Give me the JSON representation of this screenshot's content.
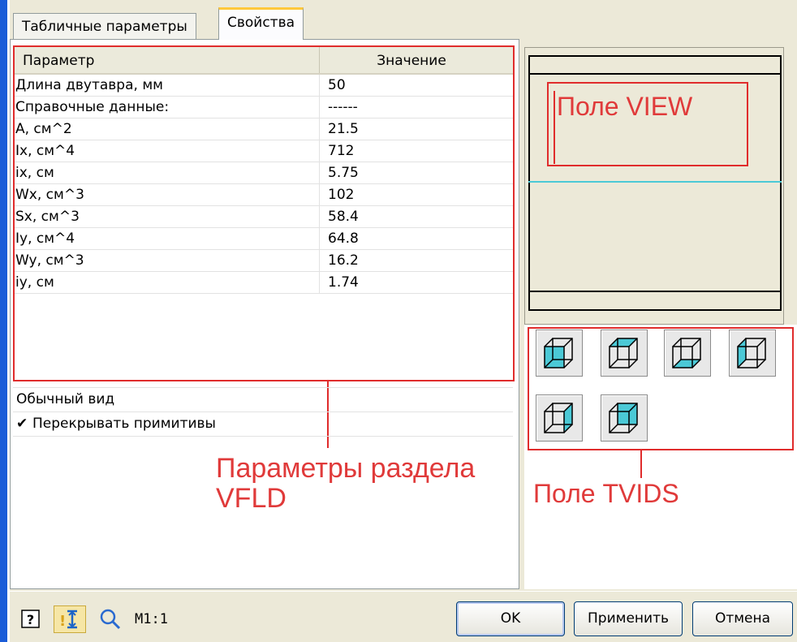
{
  "tabs": [
    {
      "label": "Табличные параметры",
      "active": false
    },
    {
      "label": "Свойства",
      "active": true
    }
  ],
  "grid": {
    "header": {
      "param": "Параметр",
      "value": "Значение"
    },
    "rows": [
      {
        "param": "Длина двутавра, мм",
        "value": "50"
      },
      {
        "param": "Справочные данные:",
        "value": "------"
      },
      {
        "param": "A, см^2",
        "value": "21.5"
      },
      {
        "param": "Ix, см^4",
        "value": "712"
      },
      {
        "param": "ix, см",
        "value": "5.75"
      },
      {
        "param": "Wx, см^3",
        "value": "102"
      },
      {
        "param": "Sx, см^3",
        "value": "58.4"
      },
      {
        "param": "Iy, см^4",
        "value": "64.8"
      },
      {
        "param": "Wy, см^3",
        "value": "16.2"
      },
      {
        "param": "iy, см",
        "value": "1.74"
      }
    ]
  },
  "options": {
    "view_mode": "Обычный вид",
    "overlap_checkbox": {
      "label": "Перекрывать примитивы",
      "checked": true
    }
  },
  "annotations": {
    "view_label": "Поле VIEW",
    "vfld_label_line1": "Параметры раздела",
    "vfld_label_line2": "VFLD",
    "tvids_label": "Поле TVIDS"
  },
  "view_buttons": [
    {
      "icon": "cube-face-front-icon"
    },
    {
      "icon": "cube-face-top-icon"
    },
    {
      "icon": "cube-face-bottom-icon"
    },
    {
      "icon": "cube-face-left-icon"
    },
    {
      "icon": "cube-face-right-icon"
    },
    {
      "icon": "cube-face-back-icon"
    }
  ],
  "bottombar": {
    "zoom_label": "M1:1",
    "ok_label": "OK",
    "apply_label": "Применить",
    "cancel_label": "Отмена"
  },
  "colors": {
    "annotation": "#e02c2c",
    "cube_fill": "#4bc9d6",
    "view_cyan": "#4bc9d6",
    "left_edge": "#1a5cd8"
  }
}
